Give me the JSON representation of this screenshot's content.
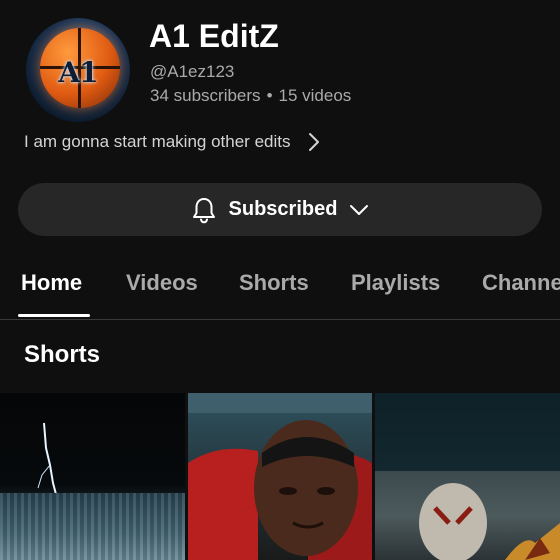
{
  "channel": {
    "name": "A1 EditZ",
    "handle": "@A1ez123",
    "subscribers": "34 subscribers",
    "separator": "•",
    "videos": "15 videos",
    "description": "I am gonna start making other edits",
    "avatar_text": "A1"
  },
  "subscribe": {
    "label": "Subscribed",
    "icon": "bell-icon",
    "dropdown_icon": "chevron-down-icon"
  },
  "tabs": [
    {
      "label": "Home",
      "active": true
    },
    {
      "label": "Videos",
      "active": false
    },
    {
      "label": "Shorts",
      "active": false
    },
    {
      "label": "Playlists",
      "active": false
    },
    {
      "label": "Channels",
      "active": false
    }
  ],
  "section": {
    "title": "Shorts"
  },
  "colors": {
    "background": "#0f0f0f",
    "button_bg": "#272727",
    "secondary_text": "#aaaaaa"
  }
}
